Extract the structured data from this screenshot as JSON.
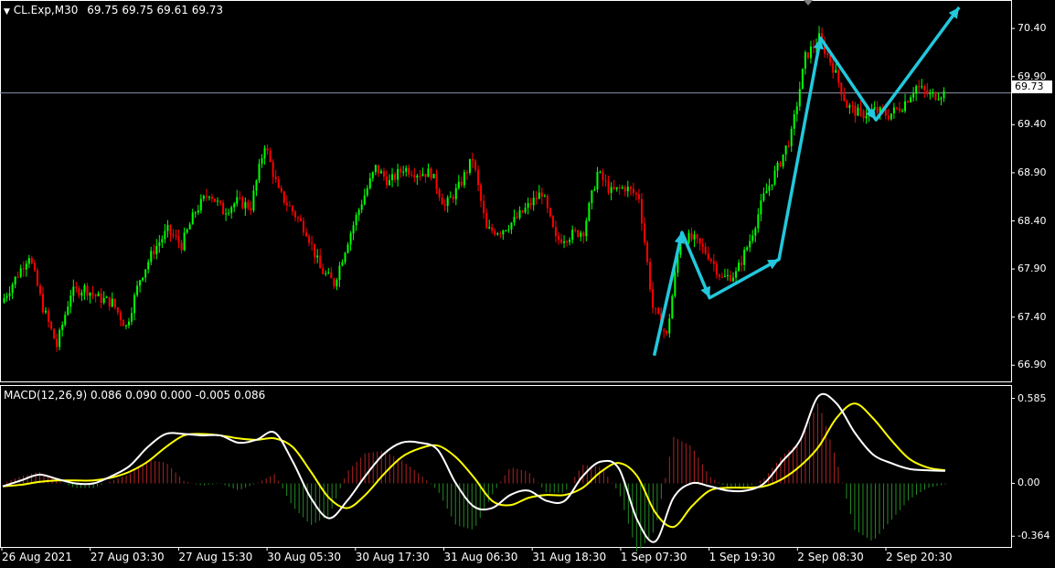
{
  "chart_header": {
    "symbol": "CL.Exp,M30",
    "ohlc": "69.75 69.75 69.61 69.73"
  },
  "indicator_header": {
    "label": "MACD(12,26,9) 0.086 0.090 0.000 -0.005 0.086"
  },
  "current_price": "69.73",
  "price_axis": {
    "ticks": [
      "70.40",
      "69.90",
      "69.40",
      "68.90",
      "68.40",
      "67.90",
      "67.40",
      "66.90"
    ],
    "ylim": [
      66.76,
      70.62
    ]
  },
  "macd_axis": {
    "ticks": [
      "0.585",
      "0.00",
      "-0.364"
    ],
    "ylim": [
      -0.4,
      0.62
    ]
  },
  "time_axis": {
    "labels": [
      "26 Aug 2021",
      "27 Aug 03:30",
      "27 Aug 15:30",
      "30 Aug 05:30",
      "30 Aug 17:30",
      "31 Aug 06:30",
      "31 Aug 18:30",
      "1 Sep 07:30",
      "1 Sep 19:30",
      "2 Sep 08:30",
      "2 Sep 20:30"
    ]
  },
  "colors": {
    "background": "#000000",
    "bull_candle": "#00ff00",
    "bear_candle": "#ff0000",
    "zigzag": "#22c8dc",
    "macd_line": "#ffffff",
    "signal_line": "#ffff00",
    "hist_positive": "#b22222",
    "hist_negative": "#228b22",
    "grid_frame": "#ffffff"
  },
  "chart_data": [
    {
      "type": "candlestick",
      "title": "CL.Exp,M30",
      "series": [
        {
          "name": "Close",
          "values": [
            67.55,
            67.8,
            68.05,
            67.5,
            67.1,
            67.65,
            67.7,
            67.6,
            67.55,
            67.3,
            67.8,
            68.1,
            68.3,
            68.15,
            68.5,
            68.7,
            68.5,
            68.6,
            68.55,
            69.2,
            68.7,
            68.5,
            68.3,
            67.9,
            67.75,
            68.2,
            68.6,
            68.95,
            68.8,
            68.95,
            68.9,
            68.9,
            68.55,
            68.75,
            69.05,
            68.3,
            68.3,
            68.4,
            68.55,
            68.7,
            68.2,
            68.25,
            68.3,
            68.9,
            68.7,
            68.75,
            68.65,
            67.5,
            67.2,
            68.25,
            68.2,
            68.05,
            67.8,
            67.85,
            68.2,
            68.65,
            68.95,
            69.3,
            70.1,
            70.3,
            70.0,
            69.6,
            69.5,
            69.55,
            69.5,
            69.6,
            69.8,
            69.7,
            69.73
          ]
        }
      ],
      "zigzag_points": [
        [
          47,
          67.0
        ],
        [
          49,
          68.28
        ],
        [
          51,
          67.6
        ],
        [
          56,
          68.0
        ],
        [
          59,
          70.3
        ],
        [
          63,
          69.45
        ],
        [
          69,
          70.62
        ]
      ],
      "current_price_line": 69.73,
      "ylim": [
        66.76,
        70.62
      ],
      "grid": false
    },
    {
      "type": "line",
      "title": "MACD(12,26,9) 0.086 0.090 0.000 -0.005 0.086",
      "series": [
        {
          "name": "MACD",
          "values": [
            -0.02,
            0.02,
            0.06,
            0.03,
            0.0,
            0.0,
            0.05,
            0.12,
            0.25,
            0.34,
            0.34,
            0.33,
            0.33,
            0.28,
            0.3,
            0.35,
            0.15,
            -0.1,
            -0.24,
            -0.12,
            0.05,
            0.2,
            0.28,
            0.28,
            0.23,
            0.0,
            -0.16,
            -0.17,
            -0.08,
            -0.05,
            -0.12,
            -0.12,
            0.05,
            0.15,
            0.1,
            -0.25,
            -0.4,
            -0.1,
            0.0,
            -0.02,
            -0.05,
            -0.05,
            0.0,
            0.15,
            0.3,
            0.6,
            0.55,
            0.35,
            0.2,
            0.14,
            0.1,
            0.09,
            0.086
          ]
        },
        {
          "name": "Signal",
          "values": [
            -0.02,
            -0.01,
            0.01,
            0.02,
            0.02,
            0.02,
            0.04,
            0.08,
            0.15,
            0.25,
            0.33,
            0.34,
            0.33,
            0.31,
            0.3,
            0.31,
            0.25,
            0.08,
            -0.1,
            -0.17,
            -0.08,
            0.06,
            0.18,
            0.24,
            0.26,
            0.18,
            0.04,
            -0.12,
            -0.15,
            -0.1,
            -0.08,
            -0.08,
            -0.03,
            0.08,
            0.14,
            0.05,
            -0.2,
            -0.3,
            -0.16,
            -0.05,
            -0.03,
            -0.03,
            -0.02,
            0.03,
            0.12,
            0.25,
            0.45,
            0.55,
            0.45,
            0.3,
            0.17,
            0.11,
            0.09
          ]
        }
      ],
      "ylim": [
        -0.4,
        0.62
      ]
    }
  ]
}
